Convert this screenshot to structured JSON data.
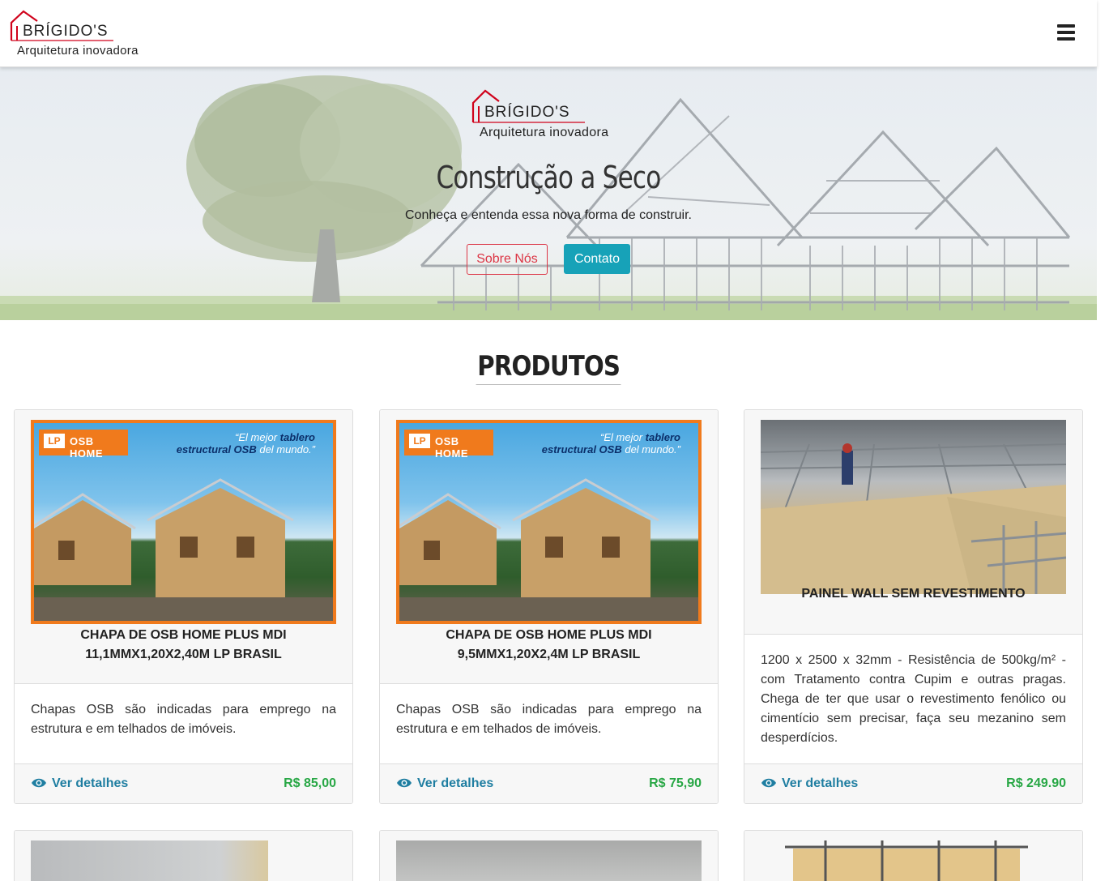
{
  "brand": {
    "name": "BRÍGIDO'S",
    "tagline": "Arquitetura inovadora"
  },
  "nav": {
    "menu_icon": "hamburger-menu-icon"
  },
  "hero": {
    "title": "Construção a Seco",
    "subtitle": "Conheça e entenda essa nova forma de construir.",
    "btn_about": "Sobre Nós",
    "btn_contact": "Contato"
  },
  "section": {
    "title": "PRODUTOS"
  },
  "ad": {
    "lp_badge": "LP",
    "lp_product": "OSB HOME",
    "quote_line1_a": "“El mejor ",
    "quote_line1_b": "tablero",
    "quote_line2_a": "estructural OSB",
    "quote_line2_b": " del mundo.”"
  },
  "products": [
    {
      "name": "CHAPA DE OSB HOME PLUS MDI 11,1MMX1,20X2,40M LP BRASIL",
      "description": "Chapas OSB são indicadas para emprego na estrutura e em telhados de imóveis.",
      "details_label": "Ver detalhes",
      "price": "R$ 85,00"
    },
    {
      "name": "CHAPA DE OSB HOME PLUS MDI 9,5MMX1,20X2,4M LP BRASIL",
      "description": "Chapas OSB são indicadas para emprego na estrutura e em telhados de imóveis.",
      "details_label": "Ver detalhes",
      "price": "R$ 75,90"
    },
    {
      "name": "PAINEL WALL SEM REVESTIMENTO",
      "description": "1200 x 2500 x 32mm - Resistência de 500kg/m² - com Tratamento contra Cupim e outras pragas. Chega de ter que usar o revestimento fenólico ou cimentício sem precisar, faça seu mezanino sem desperdícios.",
      "details_label": "Ver detalhes",
      "price": "R$ 249.90"
    }
  ],
  "colors": {
    "accent_link": "#1f7ea1",
    "price": "#28a745",
    "danger": "#dc3545",
    "info": "#17a2b8",
    "osb_orange": "#f07a1c"
  }
}
